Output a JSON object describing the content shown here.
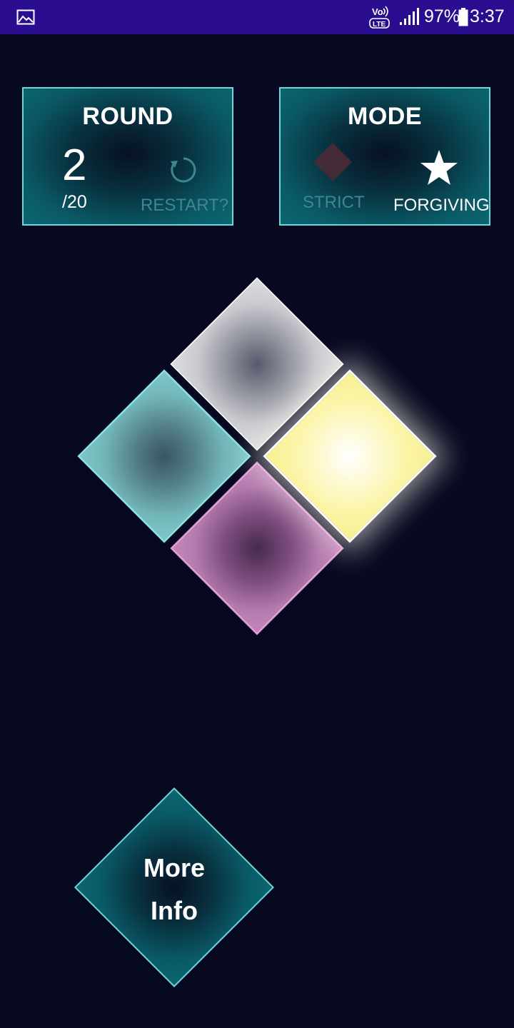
{
  "status_bar": {
    "icons": [
      "gallery-icon",
      "volte-icon",
      "signal-icon",
      "battery-icon"
    ],
    "volte_top": "Vo",
    "volte_bottom": "LTE",
    "battery": "97%",
    "time": "3:37",
    "color": "#2a0d8e"
  },
  "round_panel": {
    "title": "ROUND",
    "current": "2",
    "total": "/20",
    "restart_label": "RESTART?"
  },
  "mode_panel": {
    "title": "MODE",
    "strict_label": "STRICT",
    "forgiving_label": "FORGIVING",
    "selected": "FORGIVING"
  },
  "board": {
    "tiles": [
      {
        "name": "top",
        "color": "#dcdce0",
        "lit": false
      },
      {
        "name": "left",
        "color": "#7fc6c8",
        "lit": false
      },
      {
        "name": "right",
        "color": "#f8ef90",
        "lit": true
      },
      {
        "name": "bottom",
        "color": "#c287bb",
        "lit": false
      }
    ]
  },
  "more_info": {
    "line1": "More",
    "line2": "Info"
  },
  "colors": {
    "background": "#070920",
    "panel_border": "#6fd6da",
    "dim_text": "#3f8790"
  }
}
